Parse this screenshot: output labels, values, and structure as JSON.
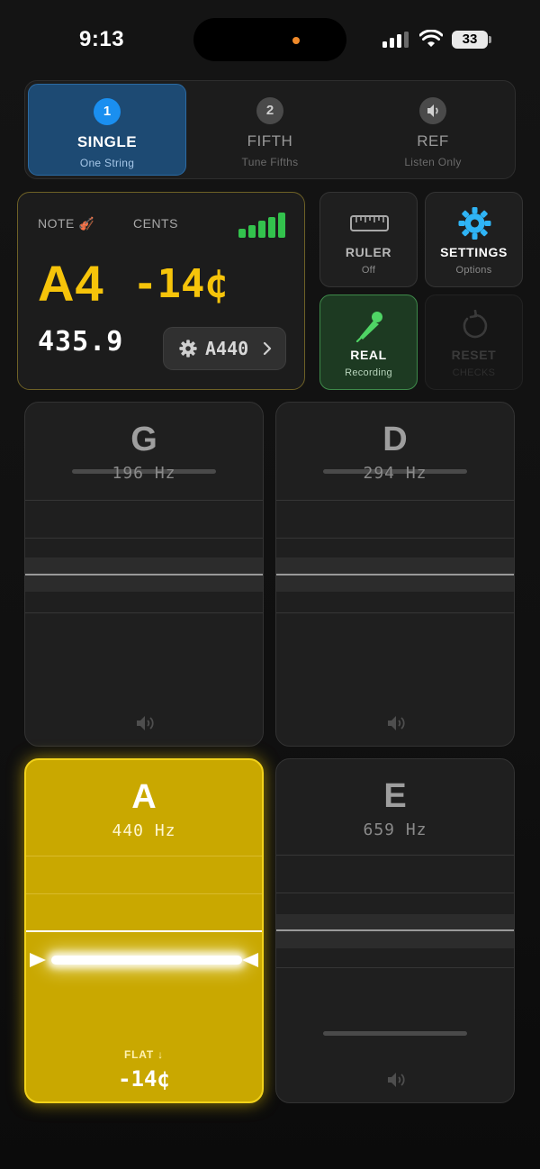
{
  "status_bar": {
    "time": "9:13",
    "battery": "33"
  },
  "modes": [
    {
      "number": "1",
      "title": "SINGLE",
      "subtitle": "One String",
      "active": true
    },
    {
      "number": "2",
      "title": "FIFTH",
      "subtitle": "Tune Fifths",
      "active": false
    },
    {
      "icon": "speaker-icon",
      "title": "REF",
      "subtitle": "Listen Only",
      "active": false
    }
  ],
  "note_panel": {
    "note_label": "NOTE",
    "note_emoji": "🎻",
    "cents_label": "CENTS",
    "note": "A4",
    "cents": "-14¢",
    "frequency": "435.9",
    "reference": "A440",
    "signal_level": 5
  },
  "tools": {
    "ruler": {
      "title": "RULER",
      "subtitle": "Off",
      "icon": "ruler-icon"
    },
    "settings": {
      "title": "SETTINGS",
      "subtitle": "Options",
      "icon": "gear-icon"
    },
    "real": {
      "title": "REAL",
      "subtitle": "Recording",
      "icon": "microphone-icon"
    },
    "reset": {
      "title": "RESET",
      "subtitle": "CHECKS",
      "icon": "reset-icon",
      "disabled": true
    }
  },
  "strings": [
    {
      "letter": "G",
      "hz": "196 Hz",
      "active": false
    },
    {
      "letter": "D",
      "hz": "294 Hz",
      "active": false
    },
    {
      "letter": "A",
      "hz": "440 Hz",
      "active": true,
      "direction": "FLAT ↓",
      "cents": "-14¢"
    },
    {
      "letter": "E",
      "hz": "659 Hz",
      "active": false
    }
  ],
  "colors": {
    "accent_yellow": "#f6c40a",
    "active_string": "#c9a800",
    "mode_active": "#1d4a73",
    "recording_green": "#3e8a4a",
    "settings_blue": "#2fb4f5"
  }
}
